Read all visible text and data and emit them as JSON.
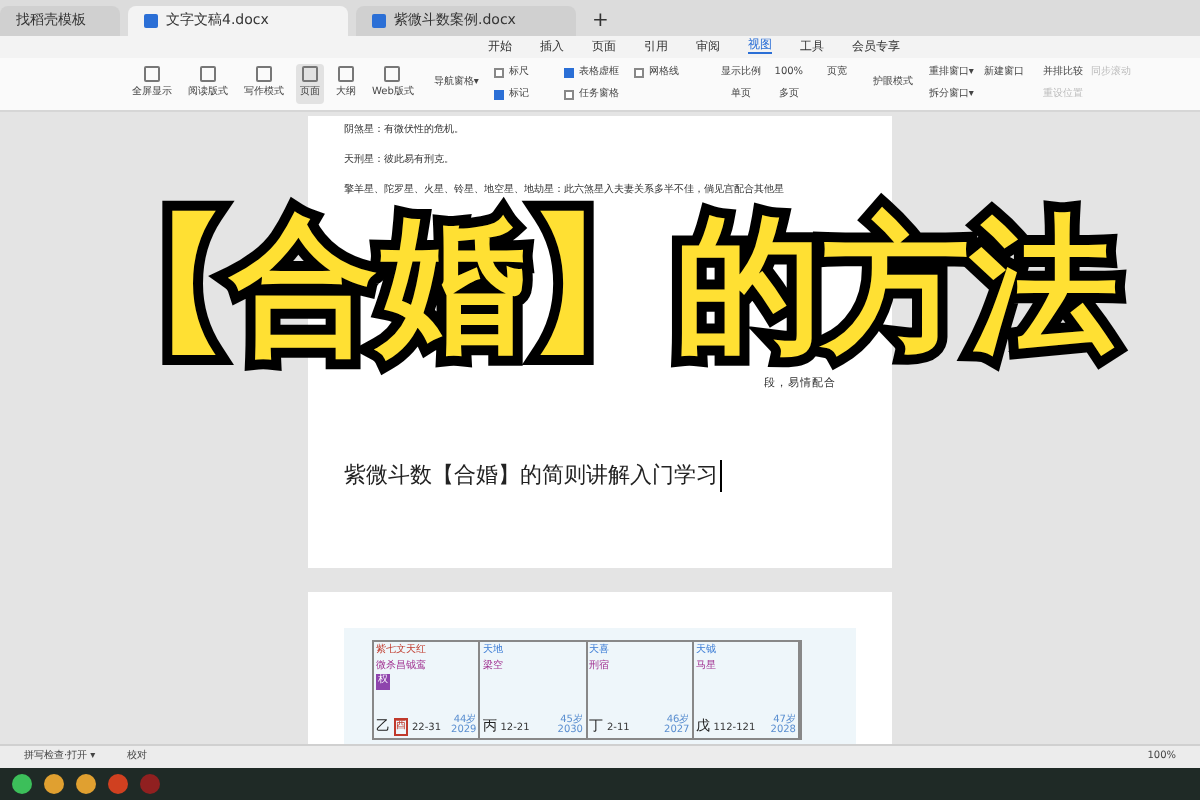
{
  "tabs": [
    {
      "label": "找稻壳模板",
      "selected": false
    },
    {
      "label": "文字文稿4.docx",
      "selected": true
    },
    {
      "label": "紫微斗数案例.docx",
      "selected": false
    }
  ],
  "new_tab": "+",
  "menu": [
    {
      "label": "开始",
      "selected": false
    },
    {
      "label": "插入",
      "selected": false
    },
    {
      "label": "页面",
      "selected": false
    },
    {
      "label": "引用",
      "selected": false
    },
    {
      "label": "审阅",
      "selected": false
    },
    {
      "label": "视图",
      "selected": true
    },
    {
      "label": "工具",
      "selected": false
    },
    {
      "label": "会员专享",
      "selected": false
    }
  ],
  "ribbon": {
    "views": [
      {
        "label": "全屏显示",
        "selected": false
      },
      {
        "label": "阅读版式",
        "selected": false
      },
      {
        "label": "写作模式",
        "selected": false
      },
      {
        "label": "页面",
        "selected": true
      },
      {
        "label": "大纲",
        "selected": false
      },
      {
        "label": "Web版式",
        "selected": false
      }
    ],
    "nav": "导航窗格▾",
    "checks": [
      {
        "label": "标尺",
        "checked": false
      },
      {
        "label": "表格虚框",
        "checked": true
      },
      {
        "label": "网格线",
        "checked": false
      },
      {
        "label": "标记",
        "checked": true
      },
      {
        "label": "任务窗格",
        "checked": false
      }
    ],
    "zoom": [
      {
        "label": "显示比例"
      },
      {
        "label": "100%"
      },
      {
        "label": "页宽"
      },
      {
        "label": "单页"
      },
      {
        "label": "多页"
      }
    ],
    "eye": "护眼模式",
    "windows": [
      {
        "label": "重排窗口▾"
      },
      {
        "label": "新建窗口"
      },
      {
        "label": "拆分窗口▾"
      }
    ],
    "compare": [
      {
        "label": "并排比较",
        "disabled": false
      },
      {
        "label": "同步滚动",
        "disabled": true
      },
      {
        "label": "重设位置",
        "disabled": true
      }
    ]
  },
  "document": {
    "paragraphs": [
      "阴煞星：有微伏性的危机。",
      "天刑星：彼此易有刑克。",
      "擎羊星、陀罗星、火星、铃星、地空星、地劫星：此六煞星入夫妻关系多半不佳，倘见宫配合其他星"
    ],
    "fragments": [
      "段，易情配合"
    ],
    "heading": "紫微斗数【合婚】的简则讲解入门学习"
  },
  "overlay_title": "【合婚】的方法",
  "chart": {
    "cells": [
      {
        "stars": [
          "紫七文天红",
          "微杀昌钺鸾"
        ],
        "badge": "权",
        "stem": "乙",
        "branch": "酉",
        "range": "22-31",
        "age": "44岁",
        "year": "2029"
      },
      {
        "stars": [
          "天地",
          "梁空"
        ],
        "stem": "丙",
        "range": "12-21",
        "age": "45岁",
        "year": "2030"
      },
      {
        "stars": [
          "天喜",
          "刑宿"
        ],
        "stem": "丁",
        "range": "2-11",
        "age": "46岁",
        "year": "2027"
      },
      {
        "stars": [
          "天钺",
          "马星"
        ],
        "stem": "戊",
        "range": "112-121",
        "age": "47岁",
        "year": "2028"
      }
    ]
  },
  "status_bar": {
    "left": [
      "拼写检查·打开 ▾",
      "校对"
    ],
    "zoom": "100%"
  }
}
